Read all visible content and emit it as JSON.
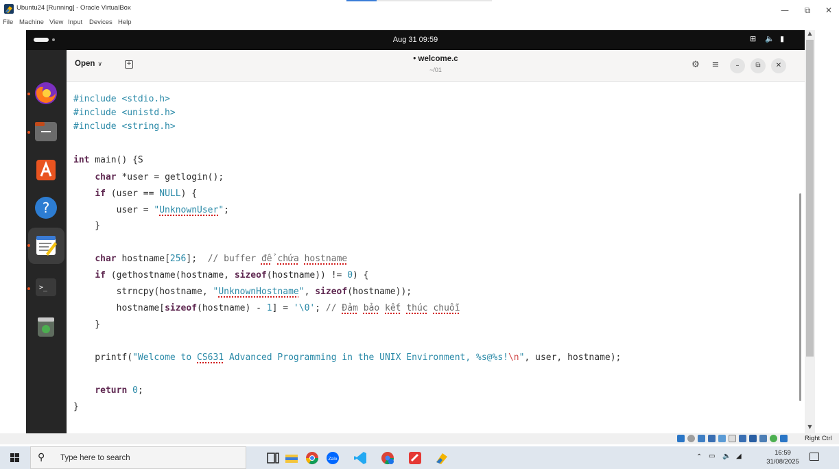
{
  "host_window": {
    "title": "Ubuntu24 [Running] - Oracle VirtualBox",
    "menu": [
      "File",
      "Machine",
      "View",
      "Input",
      "Devices",
      "Help"
    ],
    "controls": {
      "minimize": "—",
      "maximize": "⧉",
      "close": "✕"
    }
  },
  "guest": {
    "clock": "Aug 31  09:59",
    "tray_icons": [
      "network-icon",
      "volume-icon",
      "power-icon"
    ],
    "dock": [
      {
        "name": "firefox",
        "running": true
      },
      {
        "name": "files",
        "running": true
      },
      {
        "name": "app-center",
        "running": false
      },
      {
        "name": "help",
        "running": false
      },
      {
        "name": "text-editor",
        "running": true,
        "active": true
      },
      {
        "name": "terminal",
        "running": true
      },
      {
        "name": "trash",
        "running": false
      }
    ]
  },
  "editor": {
    "open_label": "Open",
    "title": "• welcome.c",
    "path": "~/01",
    "code_lines": [
      "#include <stdio.h>",
      "#include <unistd.h>",
      "#include <string.h>",
      "",
      "int main() {S",
      "    char *user = getlogin();",
      "    if (user == NULL) {",
      "        user = \"UnknownUser\";",
      "    }",
      "",
      "    char hostname[256];  // buffer để chứa hostname",
      "    if (gethostname(hostname, sizeof(hostname)) != 0) {",
      "        strncpy(hostname, \"UnknownHostname\", sizeof(hostname));",
      "        hostname[sizeof(hostname) - 1] = '\\0'; // Đảm bảo kết thúc chuỗi",
      "    }",
      "",
      "    printf(\"Welcome to CS631 Advanced Programming in the UNIX Environment, %s@%s!\\n\", user, hostname);",
      "",
      "    return 0;",
      "}"
    ]
  },
  "vb_status": {
    "host_key": "Right Ctrl"
  },
  "taskbar": {
    "search_placeholder": "Type here to search",
    "apps": [
      "task-view",
      "file-explorer",
      "chrome",
      "zalo",
      "vscode",
      "chrome-profile",
      "app-red",
      "virtualbox"
    ],
    "time": "16:59",
    "date": "31/08/2025"
  },
  "colors": {
    "keyword": "#5e2750",
    "literal": "#2b8aa8",
    "spell_error": "#d11a1a",
    "ubuntu_orange": "#e95420"
  }
}
